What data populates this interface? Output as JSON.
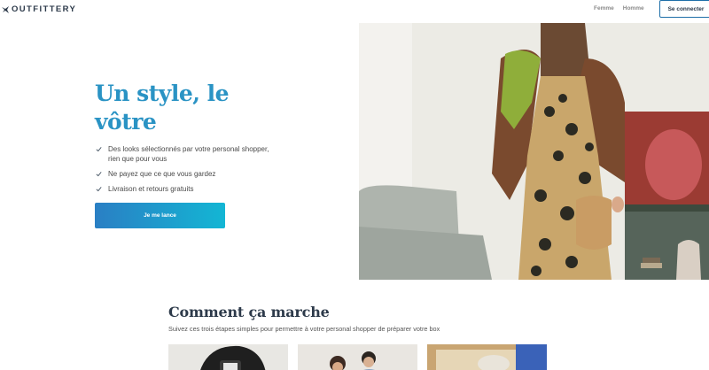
{
  "header": {
    "logo_text": "OUTFITTERY",
    "nav": [
      "Femme",
      "Homme"
    ],
    "login_label": "Se connecter"
  },
  "hero": {
    "title_line1": "Un style, le",
    "title_line2": "vôtre",
    "features": [
      "Des looks sélectionnés par votre personal shopper, rien que pour vous",
      "Ne payez que ce que vous gardez",
      "Livraison et retours gratuits"
    ],
    "cta_label": "Je me lance"
  },
  "how_it_works": {
    "title": "Comment ça marche",
    "subtitle": "Suivez ces trois étapes simples pour permettre à votre personal shopper de préparer votre box"
  },
  "colors": {
    "accent": "#2a93c4",
    "cta_start": "#2a7fc4",
    "cta_end": "#13b6d4",
    "dark": "#2d3a4a"
  },
  "icons": [
    "logo-bird-icon",
    "check-icon"
  ]
}
